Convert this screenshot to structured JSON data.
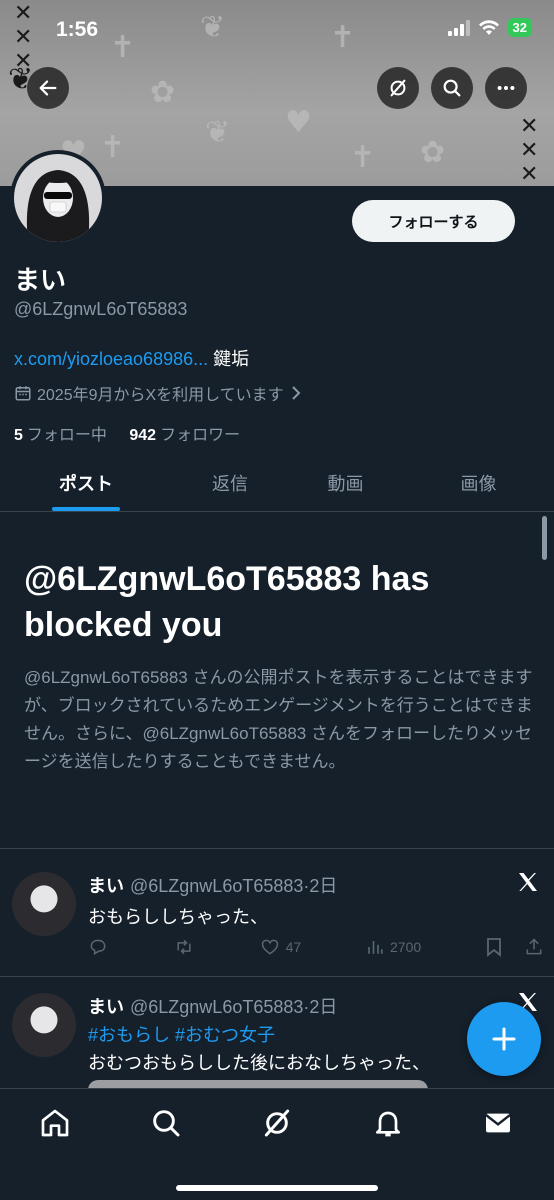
{
  "status_bar": {
    "time": "1:56",
    "battery": "32"
  },
  "banner": {
    "back_button": "back-arrow-icon",
    "actions": [
      "grok-icon",
      "search-icon",
      "more-icon"
    ]
  },
  "profile": {
    "follow_label": "フォローする",
    "display_name": "まい",
    "handle": "@6LZgnwL6oT65883",
    "bio_link": "x.com/yiozloeao68986...",
    "bio_text": "鍵垢",
    "joined": "2025年9月からXを利用しています",
    "following_count": "5",
    "following_label": "フォロー中",
    "followers_count": "942",
    "followers_label": "フォロワー"
  },
  "tabs": [
    {
      "label": "ポスト",
      "active": true
    },
    {
      "label": "返信",
      "active": false
    },
    {
      "label": "動画",
      "active": false
    },
    {
      "label": "画像",
      "active": false
    }
  ],
  "blocked": {
    "title_line1": "@6LZgnwL6oT65883 has",
    "title_line2": "blocked you",
    "description": "@6LZgnwL6oT65883 さんの公開ポストを表示することはできますが、ブロックされているためエンゲージメントを行うことはできません。さらに、@6LZgnwL6oT65883 さんをフォローしたりメッセージを送信したりすることもできません。"
  },
  "posts": [
    {
      "name": "まい",
      "handle": "@6LZgnwL6oT65883",
      "time": "·2日",
      "text": "おもらししちゃった、",
      "likes": "47",
      "views": "2700"
    },
    {
      "name": "まい",
      "handle": "@6LZgnwL6oT65883",
      "time": "·2日",
      "hashtags": "#おもらし #おむつ女子",
      "text": "おむつおもらしした後におなしちゃった、"
    }
  ],
  "colors": {
    "accent": "#1d9bf0",
    "background": "#15202b",
    "muted": "#8b98a5"
  }
}
